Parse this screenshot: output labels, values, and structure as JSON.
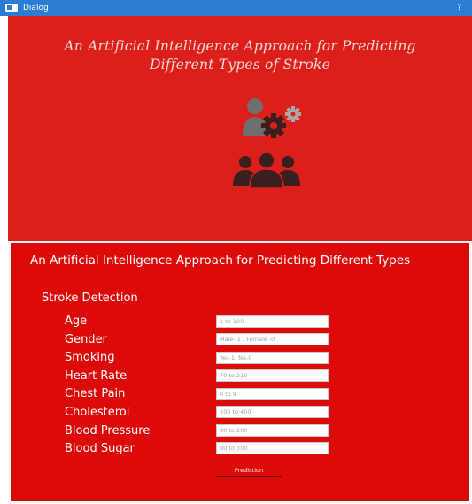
{
  "window": {
    "title": "Dialog",
    "help_glyph": "?"
  },
  "banner": {
    "title_line1": "An Artificial Intelligence Approach for Predicting",
    "title_line2": "Different Types of Stroke",
    "icons": [
      "person-gear-icon",
      "users-group-icon"
    ],
    "colors": {
      "background": "#dd1f1b",
      "icon": "#3a1f1f",
      "title_text": "#f3dcd5"
    }
  },
  "form": {
    "heading": "An Artificial Intelligence Approach for Predicting Different Types",
    "section_title": "Stroke Detection",
    "fields": [
      {
        "label": "Age",
        "placeholder": "1 to 100"
      },
      {
        "label": "Gender",
        "placeholder": "Male- 1 ; Female -0"
      },
      {
        "label": "Smoking",
        "placeholder": "Yes-1, No-0"
      },
      {
        "label": "Heart Rate",
        "placeholder": "70 to 210"
      },
      {
        "label": "Chest Pain",
        "placeholder": "0 to 9"
      },
      {
        "label": "Cholesterol",
        "placeholder": "100 to 400"
      },
      {
        "label": "Blood Pressure",
        "placeholder": "90 to 200"
      },
      {
        "label": "Blood Sugar",
        "placeholder": "80 to 300"
      }
    ],
    "predict_label": "Prediction",
    "colors": {
      "background": "#dd0a0a",
      "text": "#ffffff"
    }
  }
}
